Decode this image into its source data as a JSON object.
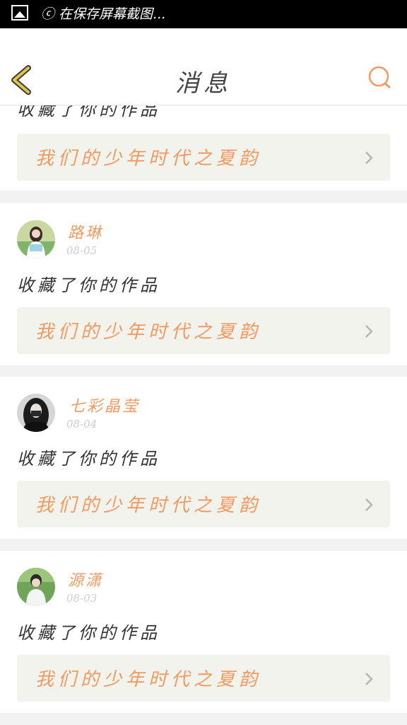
{
  "statusbar": {
    "text": "ⓒ 在保存屏幕截图...",
    "icons": [
      "image-icon"
    ]
  },
  "header": {
    "title": "消息",
    "back_icon": "back-chevron-icon",
    "search_icon": "search-icon",
    "accent_color": "#f39a61",
    "back_color": "#e0c648"
  },
  "items": [
    {
      "partial": true,
      "action": "收藏了你的作品",
      "work_title": "我们的少年时代之夏韵"
    },
    {
      "user": "路琳",
      "date": "08-05",
      "action": "收藏了你的作品",
      "work_title": "我们的少年时代之夏韵"
    },
    {
      "user": "七彩晶莹",
      "date": "08-04",
      "action": "收藏了你的作品",
      "work_title": "我们的少年时代之夏韵"
    },
    {
      "user": "源潇",
      "date": "08-03",
      "action": "收藏了你的作品",
      "work_title": "我们的少年时代之夏韵"
    }
  ]
}
